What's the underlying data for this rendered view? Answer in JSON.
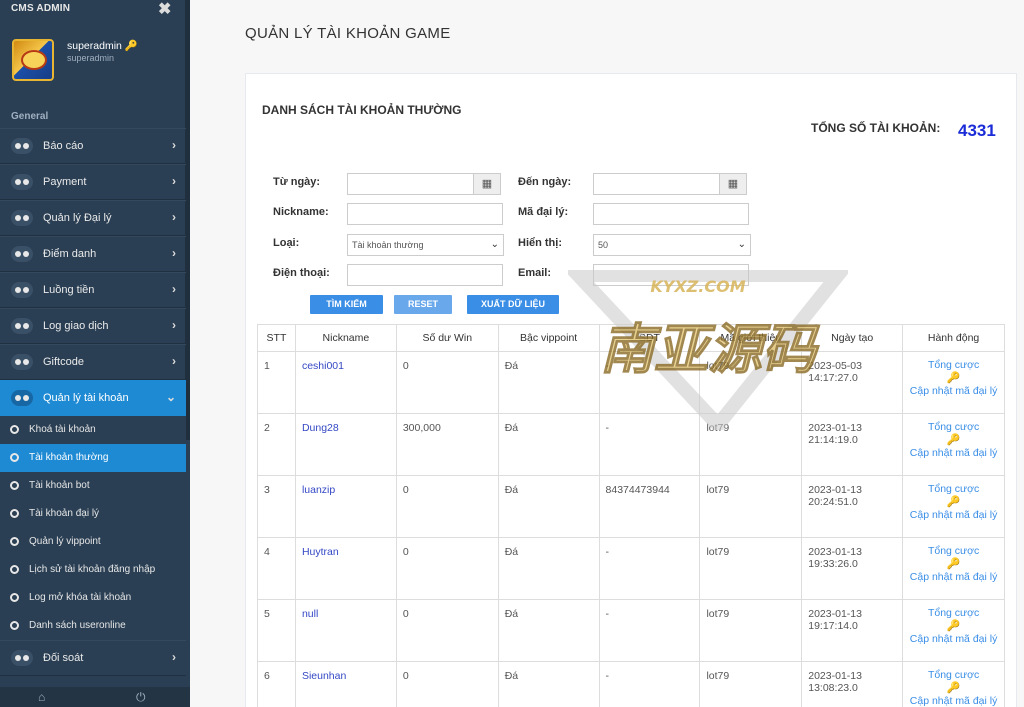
{
  "sidebar": {
    "title": "CMS ADMIN",
    "close_icon": "close-icon",
    "profile": {
      "name": "superadmin",
      "subtitle": "superadmin"
    },
    "section": "General",
    "menu": [
      {
        "label": "Báo cáo"
      },
      {
        "label": "Payment"
      },
      {
        "label": "Quản lý Đại lý"
      },
      {
        "label": "Điểm danh"
      },
      {
        "label": "Luồng tiền"
      },
      {
        "label": "Log giao dịch"
      },
      {
        "label": "Giftcode"
      },
      {
        "label": "Quản lý tài khoản"
      }
    ],
    "submenu": [
      {
        "label": "Khoá tài khoản"
      },
      {
        "label": "Tài khoản thường"
      },
      {
        "label": "Tài khoản bot"
      },
      {
        "label": "Tài khoản đại lý"
      },
      {
        "label": "Quản lý vippoint"
      },
      {
        "label": "Lịch sử tài khoản đăng nhập"
      },
      {
        "label": "Log mở khóa tài khoản"
      },
      {
        "label": "Danh sách useronline"
      }
    ],
    "last_menu": {
      "label": "Đối soát"
    },
    "footer_icons": [
      "home-icon",
      "power-icon"
    ]
  },
  "main": {
    "page_title": "QUẢN LÝ TÀI KHOẢN GAME",
    "panel_title": "DANH SÁCH TÀI KHOẢN THƯỜNG",
    "total_label": "TỔNG SỐ TÀI KHOẢN:",
    "total_value": "4331",
    "filters": {
      "from_date": "Từ ngày:",
      "to_date": "Đến ngày:",
      "nickname": "Nickname:",
      "agent_code": "Mã đại lý:",
      "type": "Loại:",
      "type_value": "Tài khoản thường",
      "show": "Hiển thị:",
      "show_value": "50",
      "phone": "Điện thoại:",
      "email": "Email:"
    },
    "buttons": {
      "search": "TÌM KIẾM",
      "reset": "RESET",
      "export": "XUẤT DỮ LIỆU"
    },
    "table": {
      "headers": [
        "STT",
        "Nickname",
        "Số dư Win",
        "Bậc vippoint",
        "SDT",
        "Mã giới thiệu",
        "Ngày tạo",
        "Hành động"
      ],
      "action_total": "Tổng cược",
      "action_update": "Cập nhật mã đại lý",
      "rows": [
        {
          "stt": "1",
          "nick": "ceshi001",
          "win": "0",
          "vip": "Đá",
          "sdt": "-",
          "ref": "lot79",
          "date": "2023-05-03 14:17:27.0"
        },
        {
          "stt": "2",
          "nick": "Dung28",
          "win": "300,000",
          "vip": "Đá",
          "sdt": "-",
          "ref": "lot79",
          "date": "2023-01-13 21:14:19.0"
        },
        {
          "stt": "3",
          "nick": "luanzip",
          "win": "0",
          "vip": "Đá",
          "sdt": "84374473944",
          "ref": "lot79",
          "date": "2023-01-13 20:24:51.0"
        },
        {
          "stt": "4",
          "nick": "Huytran",
          "win": "0",
          "vip": "Đá",
          "sdt": "-",
          "ref": "lot79",
          "date": "2023-01-13 19:33:26.0"
        },
        {
          "stt": "5",
          "nick": "null",
          "win": "0",
          "vip": "Đá",
          "sdt": "-",
          "ref": "lot79",
          "date": "2023-01-13 19:17:14.0"
        },
        {
          "stt": "6",
          "nick": "Sieunhan",
          "win": "0",
          "vip": "Đá",
          "sdt": "-",
          "ref": "lot79",
          "date": "2023-01-13 13:08:23.0"
        }
      ]
    }
  },
  "watermark": {
    "top": "KYXZ.COM",
    "main": "南亚源码"
  },
  "colors": {
    "sidebar": "#2a3f54",
    "accent": "#1e8ad3",
    "link": "#3a8ee6",
    "total": "#1a2bd8"
  }
}
